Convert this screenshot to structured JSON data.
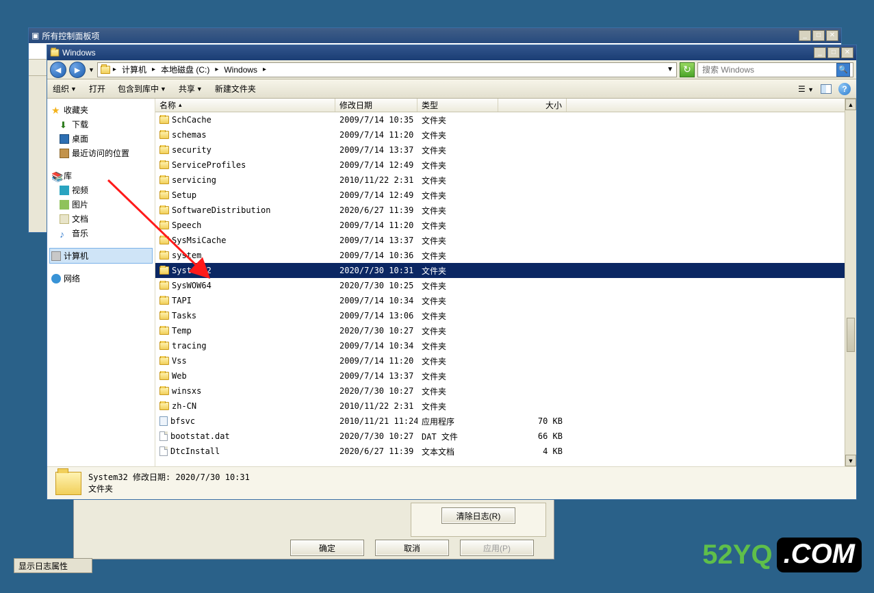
{
  "back_window": {
    "title": "所有控制面板项"
  },
  "explorer": {
    "title": "Windows",
    "breadcrumb": [
      "计算机",
      "本地磁盘 (C:)",
      "Windows"
    ],
    "search_placeholder": "搜索 Windows",
    "toolbar": {
      "organize": "组织",
      "open": "打开",
      "include": "包含到库中",
      "share": "共享",
      "newfolder": "新建文件夹"
    },
    "sidebar": {
      "favorites": "收藏夹",
      "downloads": "下载",
      "desktop": "桌面",
      "recent": "最近访问的位置",
      "libraries": "库",
      "videos": "视频",
      "pictures": "图片",
      "documents": "文档",
      "music": "音乐",
      "computer": "计算机",
      "network": "网络"
    },
    "columns": {
      "name": "名称",
      "date": "修改日期",
      "type": "类型",
      "size": "大小"
    },
    "items": [
      {
        "icon": "folder",
        "name": "SchCache",
        "date": "2009/7/14 10:35",
        "type": "文件夹",
        "size": ""
      },
      {
        "icon": "folder",
        "name": "schemas",
        "date": "2009/7/14 11:20",
        "type": "文件夹",
        "size": ""
      },
      {
        "icon": "folder",
        "name": "security",
        "date": "2009/7/14 13:37",
        "type": "文件夹",
        "size": ""
      },
      {
        "icon": "folder",
        "name": "ServiceProfiles",
        "date": "2009/7/14 12:49",
        "type": "文件夹",
        "size": ""
      },
      {
        "icon": "folder",
        "name": "servicing",
        "date": "2010/11/22 2:31",
        "type": "文件夹",
        "size": ""
      },
      {
        "icon": "folder",
        "name": "Setup",
        "date": "2009/7/14 12:49",
        "type": "文件夹",
        "size": ""
      },
      {
        "icon": "folder",
        "name": "SoftwareDistribution",
        "date": "2020/6/27 11:39",
        "type": "文件夹",
        "size": ""
      },
      {
        "icon": "folder",
        "name": "Speech",
        "date": "2009/7/14 11:20",
        "type": "文件夹",
        "size": ""
      },
      {
        "icon": "folder",
        "name": "SysMsiCache",
        "date": "2009/7/14 13:37",
        "type": "文件夹",
        "size": ""
      },
      {
        "icon": "folder",
        "name": "system",
        "date": "2009/7/14 10:36",
        "type": "文件夹",
        "size": ""
      },
      {
        "icon": "folder",
        "name": "System32",
        "date": "2020/7/30 10:31",
        "type": "文件夹",
        "size": "",
        "selected": true
      },
      {
        "icon": "folder",
        "name": "SysWOW64",
        "date": "2020/7/30 10:25",
        "type": "文件夹",
        "size": ""
      },
      {
        "icon": "folder",
        "name": "TAPI",
        "date": "2009/7/14 10:34",
        "type": "文件夹",
        "size": ""
      },
      {
        "icon": "folder",
        "name": "Tasks",
        "date": "2009/7/14 13:06",
        "type": "文件夹",
        "size": ""
      },
      {
        "icon": "folder",
        "name": "Temp",
        "date": "2020/7/30 10:27",
        "type": "文件夹",
        "size": ""
      },
      {
        "icon": "folder",
        "name": "tracing",
        "date": "2009/7/14 10:34",
        "type": "文件夹",
        "size": ""
      },
      {
        "icon": "folder",
        "name": "Vss",
        "date": "2009/7/14 11:20",
        "type": "文件夹",
        "size": ""
      },
      {
        "icon": "folder",
        "name": "Web",
        "date": "2009/7/14 13:37",
        "type": "文件夹",
        "size": ""
      },
      {
        "icon": "folder",
        "name": "winsxs",
        "date": "2020/7/30 10:27",
        "type": "文件夹",
        "size": ""
      },
      {
        "icon": "folder",
        "name": "zh-CN",
        "date": "2010/11/22 2:31",
        "type": "文件夹",
        "size": ""
      },
      {
        "icon": "app",
        "name": "bfsvc",
        "date": "2010/11/21 11:24",
        "type": "应用程序",
        "size": "70 KB"
      },
      {
        "icon": "doc",
        "name": "bootstat.dat",
        "date": "2020/7/30 10:27",
        "type": "DAT 文件",
        "size": "66 KB"
      },
      {
        "icon": "doc",
        "name": "DtcInstall",
        "date": "2020/6/27 11:39",
        "type": "文本文档",
        "size": "4 KB"
      }
    ],
    "details": {
      "line1": "System32 修改日期: 2020/7/30 10:31",
      "line2": "文件夹"
    }
  },
  "bottom_dialog": {
    "clear": "清除日志(R)",
    "ok": "确定",
    "cancel": "取消",
    "apply": "应用(P)"
  },
  "status_bar": "显示日志属性",
  "watermark": {
    "a": "52YQ",
    "b": ".COM"
  }
}
